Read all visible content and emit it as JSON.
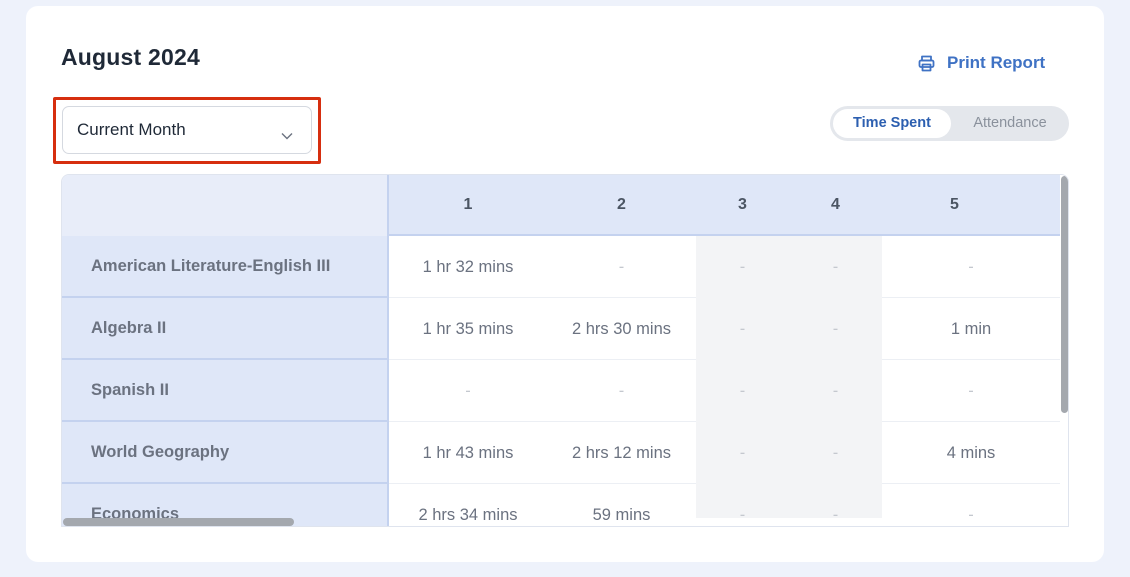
{
  "report": {
    "title": "August 2024",
    "print_label": "Print Report",
    "period_select": {
      "value": "Current Month"
    },
    "view_toggle": {
      "active": "Time Spent",
      "inactive": "Attendance"
    }
  },
  "colors": {
    "accent": "#3f72c4",
    "highlight_border": "#d62e0f",
    "header_bg": "#dfe7f8"
  },
  "table": {
    "columns": [
      "1",
      "2",
      "3",
      "4",
      "5"
    ],
    "rows": [
      {
        "course": "American Literature-English III",
        "cells": [
          "1 hr 32 mins",
          "-",
          "-",
          "-",
          "-"
        ]
      },
      {
        "course": "Algebra II",
        "cells": [
          "1 hr 35 mins",
          "2 hrs 30 mins",
          "-",
          "-",
          "1 min"
        ]
      },
      {
        "course": "Spanish II",
        "cells": [
          "-",
          "-",
          "-",
          "-",
          "-"
        ]
      },
      {
        "course": "World Geography",
        "cells": [
          "1 hr 43 mins",
          "2 hrs 12 mins",
          "-",
          "-",
          "4 mins"
        ]
      },
      {
        "course": "Economics",
        "cells": [
          "2 hrs 34 mins",
          "59 mins",
          "-",
          "-",
          "-"
        ]
      }
    ]
  }
}
